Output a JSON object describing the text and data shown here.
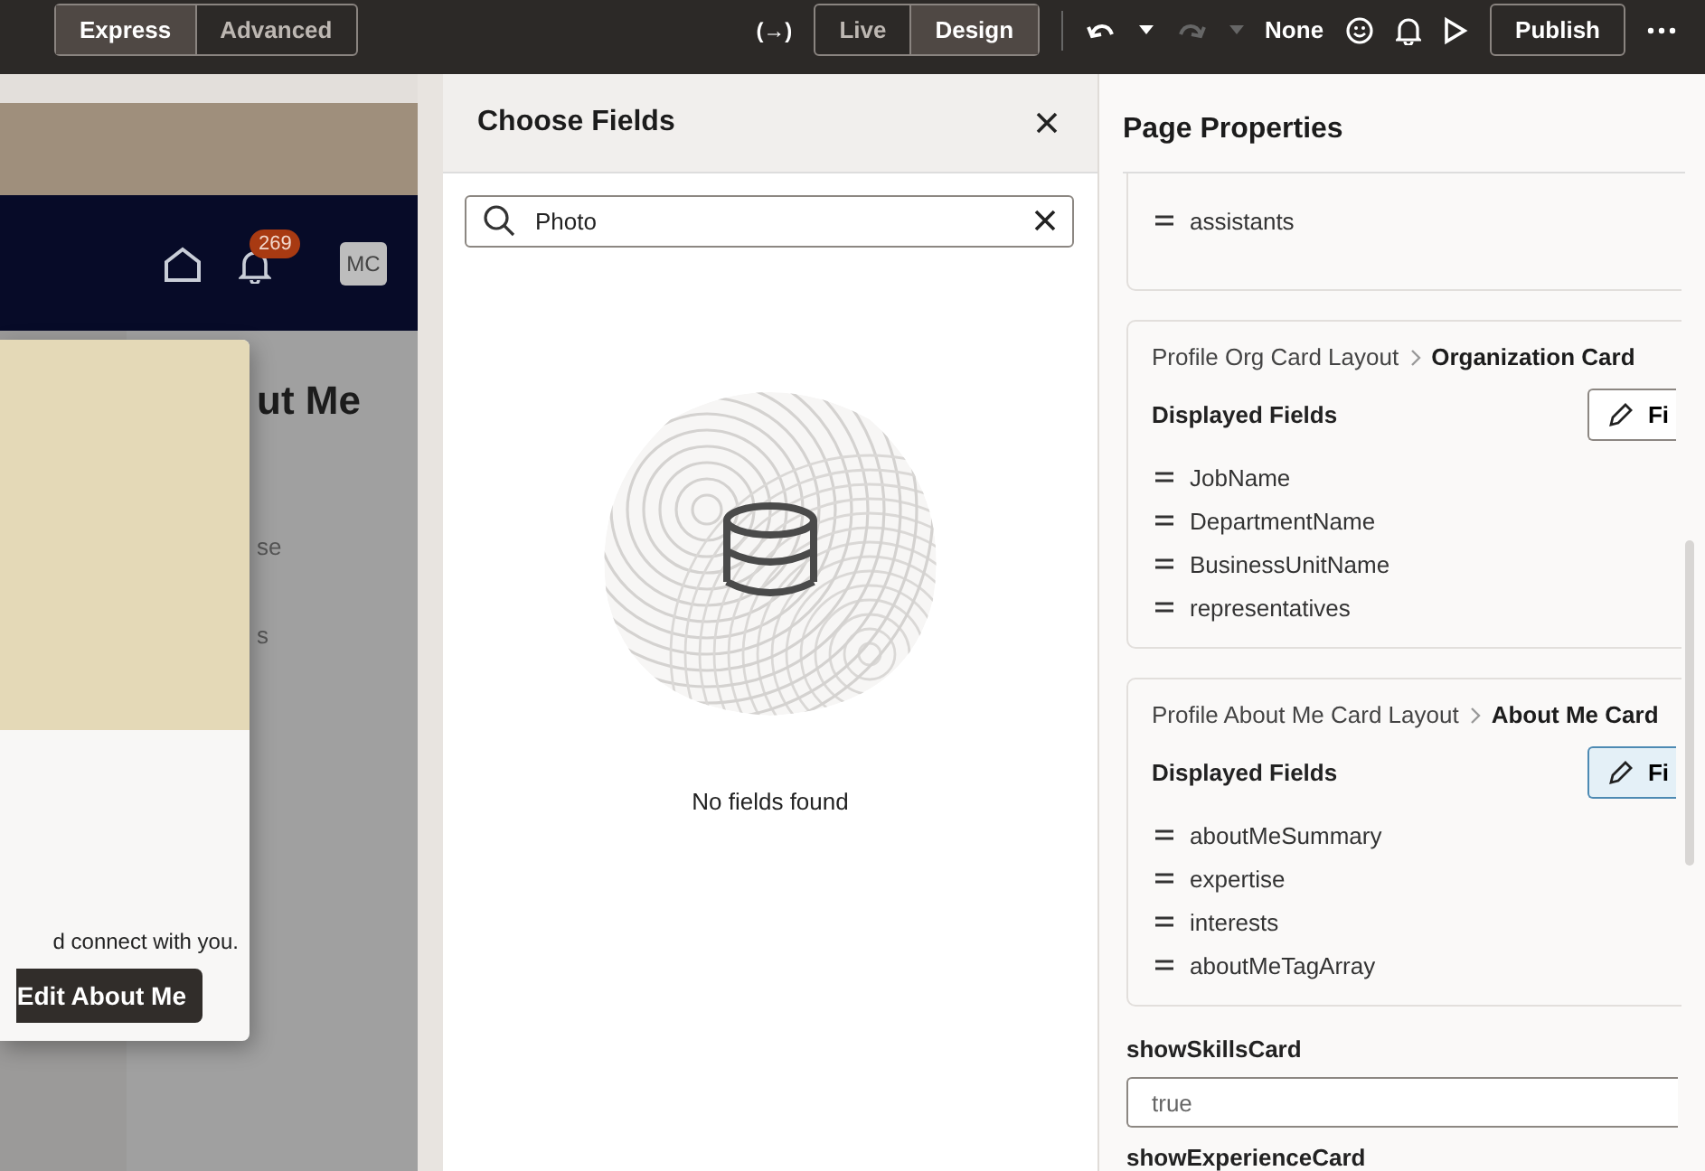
{
  "toolbar": {
    "modes": [
      {
        "label": "Express",
        "selected": true
      },
      {
        "label": "Advanced",
        "selected": false
      }
    ],
    "views": [
      {
        "label": "Live",
        "selected": false
      },
      {
        "label": "Design",
        "selected": true
      }
    ],
    "variable_glyph": "(→)",
    "undo_target": "None",
    "publish": "Publish"
  },
  "preview": {
    "badge": "269",
    "avatar": "MC",
    "heading": "ut Me",
    "snippets": [
      "se",
      "s"
    ],
    "card_text": "d connect with you.",
    "card_button": "Edit About Me"
  },
  "choose_fields": {
    "title": "Choose Fields",
    "search_value": "Photo",
    "empty_message": "No fields found"
  },
  "page_properties": {
    "title": "Page Properties",
    "partial_field": "assistants",
    "cards": [
      {
        "layout": "Profile Org Card Layout",
        "name": "Organization Card",
        "section": "Displayed Fields",
        "button": "Fi",
        "button_selected": false,
        "fields": [
          "JobName",
          "DepartmentName",
          "BusinessUnitName",
          "representatives"
        ]
      },
      {
        "layout": "Profile About Me Card Layout",
        "name": "About Me Card",
        "section": "Displayed Fields",
        "button": "Fi",
        "button_selected": true,
        "fields": [
          "aboutMeSummary",
          "expertise",
          "interests",
          "aboutMeTagArray"
        ]
      }
    ],
    "settings": [
      {
        "label": "showSkillsCard",
        "value": "true"
      }
    ],
    "next_label": "showExperienceCard"
  }
}
